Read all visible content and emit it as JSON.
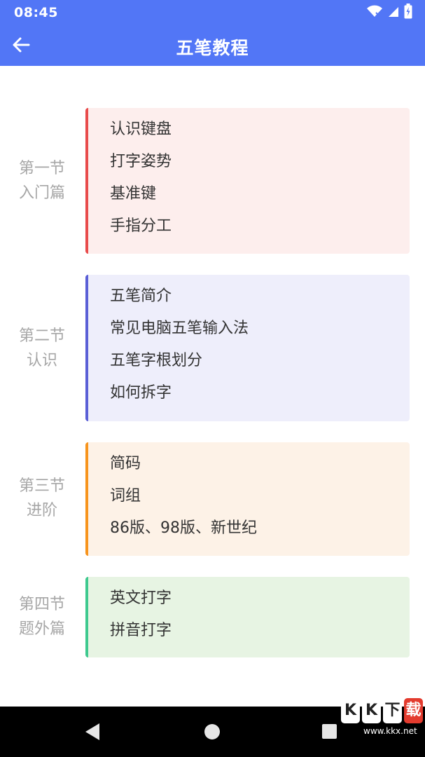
{
  "status_bar": {
    "time": "08:45",
    "icons": [
      "wifi-icon",
      "signal-icon",
      "battery-icon"
    ]
  },
  "header": {
    "title": "五笔教程",
    "back_icon": "arrow-left-icon"
  },
  "sections": [
    {
      "label_lines": [
        "第一节",
        "入门篇"
      ],
      "accent": "#e84b4b",
      "background": "#fdeeed",
      "items": [
        "认识键盘",
        "打字姿势",
        "基准键",
        "手指分工"
      ]
    },
    {
      "label_lines": [
        "第二节",
        "认识"
      ],
      "accent": "#5a5fd6",
      "background": "#eeeefb",
      "items": [
        "五笔简介",
        "常见电脑五笔输入法",
        "五笔字根划分",
        "如何拆字"
      ]
    },
    {
      "label_lines": [
        "第三节",
        "进阶"
      ],
      "accent": "#f7941d",
      "background": "#fdf2e7",
      "items": [
        "简码",
        "词组",
        "86版、98版、新世纪"
      ]
    },
    {
      "label_lines": [
        "第四节",
        "题外篇"
      ],
      "accent": "#3ec98f",
      "background": "#e7f4e3",
      "items": [
        "英文打字",
        "拼音打字"
      ]
    }
  ],
  "nav_bar": {
    "icons": [
      "nav-back-icon",
      "nav-home-icon",
      "nav-recents-icon"
    ]
  },
  "watermark": {
    "logo_chars": [
      "K",
      "K",
      "下",
      "载"
    ],
    "url": "www.kkx.net"
  }
}
